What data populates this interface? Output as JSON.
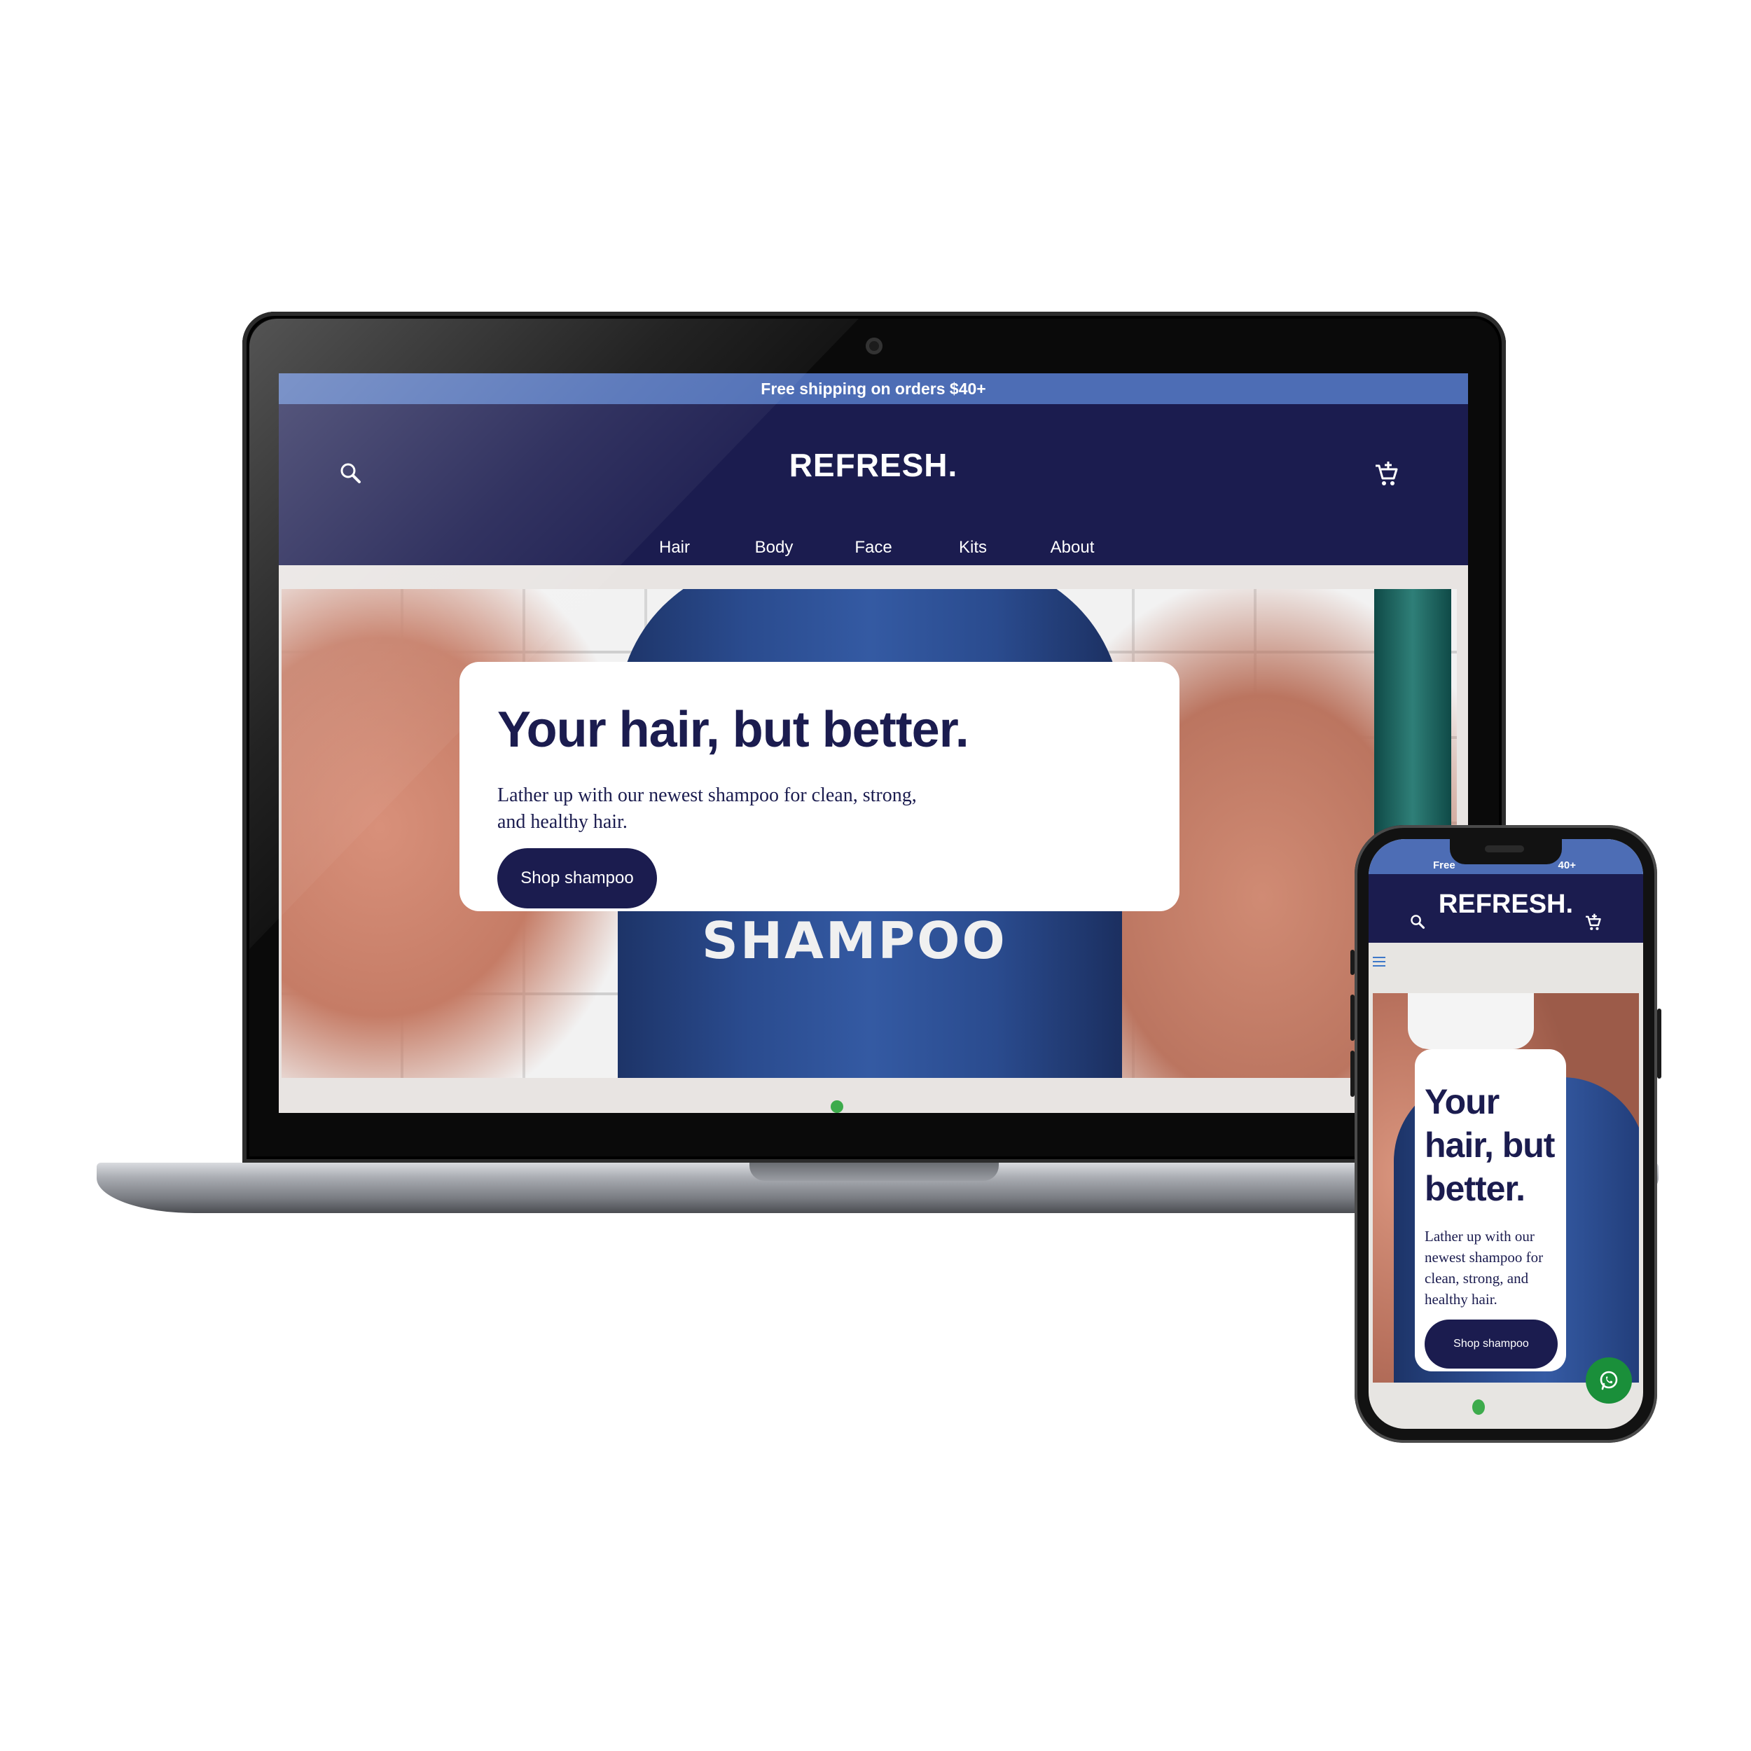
{
  "desktop": {
    "promo": "Free shipping on orders $40+",
    "logo": "REFRESH.",
    "nav": [
      "Hair",
      "Body",
      "Face",
      "Kits",
      "About"
    ],
    "hero": {
      "bottle_label": "SHAMPOO",
      "title": "Your hair, but better.",
      "subtitle": "Lather up with our newest shampoo for clean, strong, and healthy hair.",
      "cta": "Shop shampoo"
    }
  },
  "mobile": {
    "promo_left": "Free",
    "promo_right": "40+",
    "logo": "REFRESH.",
    "hero": {
      "title": "Your hair, but better.",
      "subtitle": "Lather up with our newest shampoo for clean, strong, and healthy hair.",
      "cta": "Shop shampoo"
    }
  },
  "colors": {
    "navy": "#1b1c4f",
    "promo_blue": "#4d6db5",
    "slider_dot": "#3dab4c",
    "whatsapp": "#1a8f3a"
  },
  "icons": [
    "search-icon",
    "cart-icon",
    "menu-icon",
    "whatsapp-icon"
  ]
}
